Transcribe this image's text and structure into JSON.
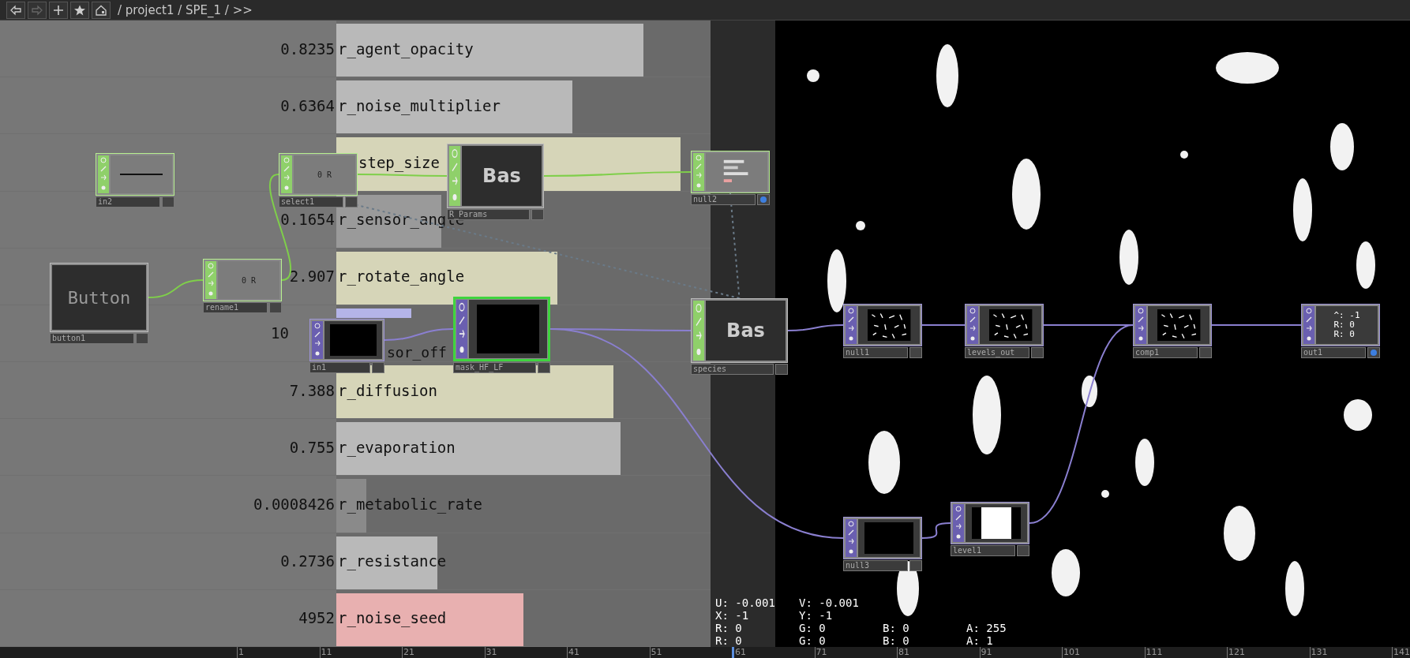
{
  "toolbar": {
    "buttons": [
      {
        "kind": "back",
        "disabled": false
      },
      {
        "kind": "forward",
        "disabled": true
      },
      {
        "kind": "add",
        "disabled": false
      },
      {
        "kind": "star",
        "disabled": false
      },
      {
        "kind": "home",
        "disabled": false
      }
    ],
    "path": "/ project1 / SPE_1 / >>"
  },
  "parameters": [
    {
      "value": "0.8235",
      "name": "r_agent_opacity",
      "level": 0.82,
      "color": "#b9b9b9"
    },
    {
      "value": "0.6364",
      "name": "r_noise_multiplier",
      "level": 0.63,
      "color": "#b9b9b9"
    },
    {
      "name": "step_size",
      "level": 0.92,
      "color": "#d6d5b8"
    },
    {
      "value": "0.1654",
      "name": "r_sensor_angle",
      "level": 0.28,
      "color": "#9a9a9a"
    },
    {
      "value": "2.907",
      "name": "r_rotate_angle",
      "level": 0.59,
      "color": "#d6d5b8"
    },
    {
      "value": "10",
      "name": "sor_off",
      "level": 0.2,
      "color": "#b4b4e8"
    },
    {
      "value": "7.388",
      "name": "r_diffusion",
      "level": 0.74,
      "color": "#d6d5b8"
    },
    {
      "value": "0.755",
      "name": "r_evaporation",
      "level": 0.76,
      "color": "#b9b9b9"
    },
    {
      "value": "0.0008426",
      "name": "r_metabolic_rate",
      "level": 0.08,
      "color": "#8a8a8a"
    },
    {
      "value": "0.2736",
      "name": "r_resistance",
      "level": 0.27,
      "color": "#b9b9b9"
    },
    {
      "value": "4952",
      "name": "r_noise_seed",
      "level": 0.5,
      "color": "#e8b0b0"
    }
  ],
  "nodes": [
    {
      "name": "in2",
      "kind": "line",
      "selected": false,
      "display": false
    },
    {
      "name": "select1",
      "kind": "label",
      "preview_text": "0 R",
      "selected": false,
      "display": false
    },
    {
      "name": "R_Params",
      "kind": "label",
      "preview_text": "Bas",
      "selected": false,
      "display": false
    },
    {
      "name": "null2",
      "kind": "bars",
      "selected": false,
      "display": true
    },
    {
      "name": "button1",
      "kind": "label",
      "preview_text": "Button",
      "selected": false,
      "display": false
    },
    {
      "name": "rename1",
      "kind": "label",
      "preview_text": "0 R",
      "selected": false,
      "display": false
    },
    {
      "name": "in1",
      "kind": "dark",
      "selected": false,
      "display": false
    },
    {
      "name": "mask_HF_LF",
      "kind": "dark",
      "selected": true,
      "display": false
    },
    {
      "name": "species",
      "kind": "label",
      "preview_text": "Bas",
      "selected": false,
      "display": false
    },
    {
      "name": "null1",
      "kind": "noise",
      "selected": false,
      "display": false
    },
    {
      "name": "levels_out",
      "kind": "noise",
      "selected": false,
      "display": false
    },
    {
      "name": "comp1",
      "kind": "noise",
      "selected": false,
      "display": false
    },
    {
      "name": "out1",
      "kind": "label",
      "preview_text": "^: -1\nR: 0\nR: 0",
      "selected": false,
      "display": true
    },
    {
      "name": "null3",
      "kind": "dark",
      "selected": false,
      "display": false
    },
    {
      "name": "level1",
      "kind": "square",
      "selected": false,
      "display": false
    }
  ],
  "readout": [
    [
      "U: -0.001",
      "V: -0.001"
    ],
    [
      "X: -1",
      "Y: -1"
    ],
    [
      "R: 0",
      "G: 0",
      "B: 0",
      "A: 255"
    ],
    [
      "R: 0",
      "G: 0",
      "B: 0",
      "A: 1"
    ]
  ],
  "timeline": [
    {
      "label": "1",
      "selected": false
    },
    {
      "label": "11",
      "selected": false
    },
    {
      "label": "21",
      "selected": false
    },
    {
      "label": "31",
      "selected": false
    },
    {
      "label": "41",
      "selected": false
    },
    {
      "label": "51",
      "selected": false
    },
    {
      "label": "61",
      "selected": true
    },
    {
      "label": "71",
      "selected": false
    },
    {
      "label": "81",
      "selected": false
    },
    {
      "label": "91",
      "selected": false
    },
    {
      "label": "101",
      "selected": false
    },
    {
      "label": "111",
      "selected": false
    },
    {
      "label": "121",
      "selected": false
    },
    {
      "label": "131",
      "selected": false
    },
    {
      "label": "141",
      "selected": false
    }
  ]
}
